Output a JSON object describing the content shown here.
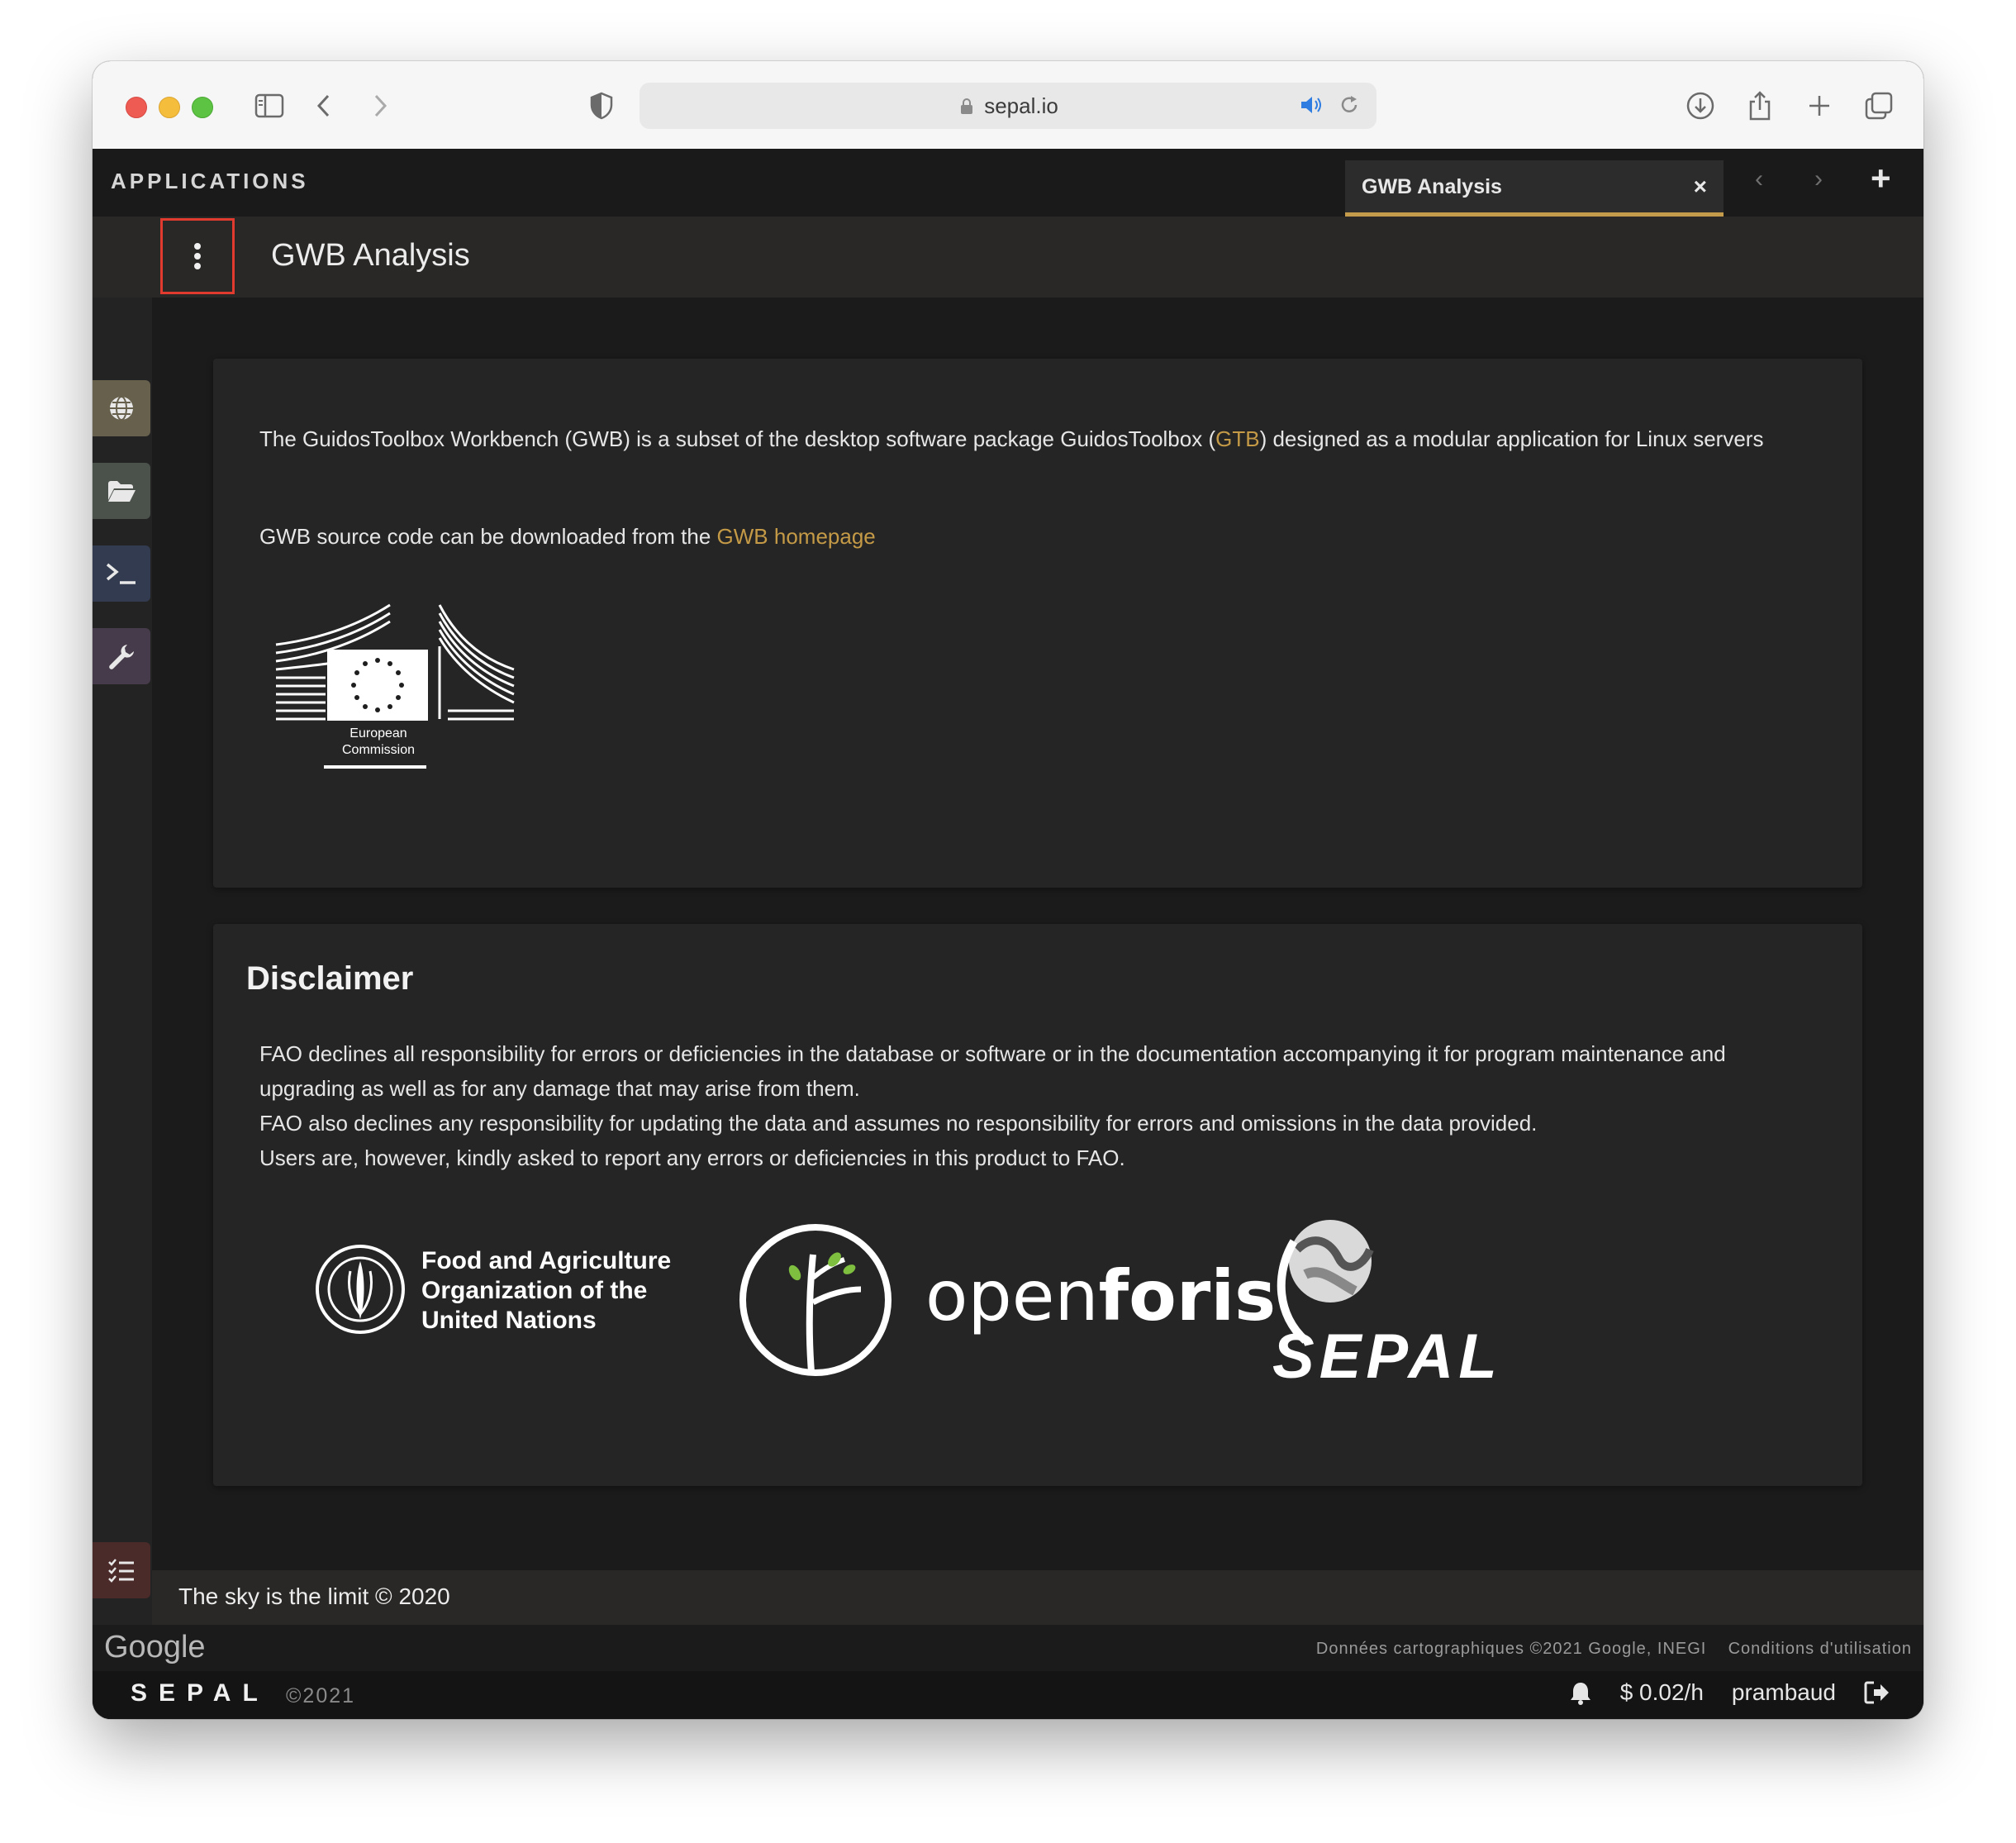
{
  "browser": {
    "url": "sepal.io"
  },
  "app": {
    "section_title": "APPLICATIONS",
    "tab_label": "GWB Analysis",
    "tab_close": "×",
    "page_title": "GWB Analysis"
  },
  "card1": {
    "text_before_gtb": "The GuidosToolbox Workbench (GWB) is a subset of the desktop software package GuidosToolbox (",
    "gtb_link": "GTB",
    "text_after_gtb": ") designed as a modular application for Linux servers",
    "source_text": "GWB source code can be downloaded from the ",
    "homepage_link": "GWB homepage",
    "ec_logo_text_1": "European",
    "ec_logo_text_2": "Commission"
  },
  "disclaimer": {
    "title": "Disclaimer",
    "line1": "FAO declines all responsibility for errors or deficiencies in the database or software or in the documentation accompanying it for program maintenance and upgrading as well as for any damage that may arise from them.",
    "line2": "FAO also declines any responsibility for updating the data and assumes no responsibility for errors and omissions in the data provided.",
    "line3": "Users are, however, kindly asked to report any errors or deficiencies in this product to FAO.",
    "fao_line1": "Food and Agriculture",
    "fao_line2": "Organization of the",
    "fao_line3": "United Nations",
    "openforis_open": "open",
    "openforis_foris": "foris",
    "sepal_logo": "SEPAL"
  },
  "footer": {
    "text": "The sky is the limit © 2020"
  },
  "map": {
    "google": "Google",
    "attribution": "Données cartographiques ©2021 Google, INEGI",
    "terms": "Conditions d'utilisation"
  },
  "status": {
    "brand": "SEPAL",
    "year": "©2021",
    "cost": "$ 0.02/h",
    "user": "prambaud"
  },
  "colors": {
    "accent": "#c49a47",
    "highlight_border": "#e03b2e"
  }
}
